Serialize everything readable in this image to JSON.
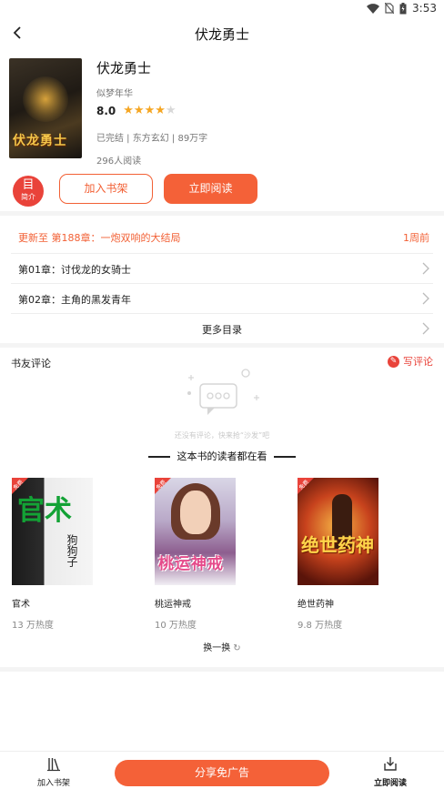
{
  "status_bar": {
    "time": "3:53",
    "icons": [
      "wifi-icon",
      "no-sim-icon",
      "battery-icon"
    ]
  },
  "nav": {
    "title": "伏龙勇士",
    "back_icon": "chevron-left-icon"
  },
  "book": {
    "title": "伏龙勇士",
    "author": "似梦年华",
    "rating": "8.0",
    "stars": 4,
    "stars_max": 5,
    "meta": "已完结 | 东方玄幻 | 89万字",
    "reads": "296人阅读",
    "cover_text": "伏龙勇士"
  },
  "actions": {
    "intro_label": "简介",
    "intro_glyph": "目",
    "add_shelf": "加入书架",
    "read_now": "立即阅读"
  },
  "chapters": {
    "update_text": "更新至 第188章：一炮双响的大结局",
    "update_time": "1周前",
    "items": [
      "第01章：讨伐龙的女骑士",
      "第02章：主角的黑发青年"
    ],
    "more": "更多目录"
  },
  "reviews": {
    "title": "书友评论",
    "write": "写评论",
    "empty_text": "还没有评论，快来抢“沙发”吧"
  },
  "recommend": {
    "title": "这本书的读者都在看",
    "badge": "免费",
    "books": [
      {
        "name": "官术",
        "heat": "13 万热度",
        "cover_main": "官术",
        "cover_sub": "狗狗子"
      },
      {
        "name": "桃运神戒",
        "heat": "10 万热度",
        "cover_main": "桃运神戒"
      },
      {
        "name": "绝世药神",
        "heat": "9.8 万热度",
        "cover_main": "绝世药神"
      }
    ],
    "refresh": "换一换"
  },
  "bottom_bar": {
    "shelf": "加入书架",
    "share": "分享免广告",
    "read": "立即阅读"
  },
  "colors": {
    "accent": "#f46138",
    "red": "#e9433a",
    "divider": "#f4f4f4"
  }
}
